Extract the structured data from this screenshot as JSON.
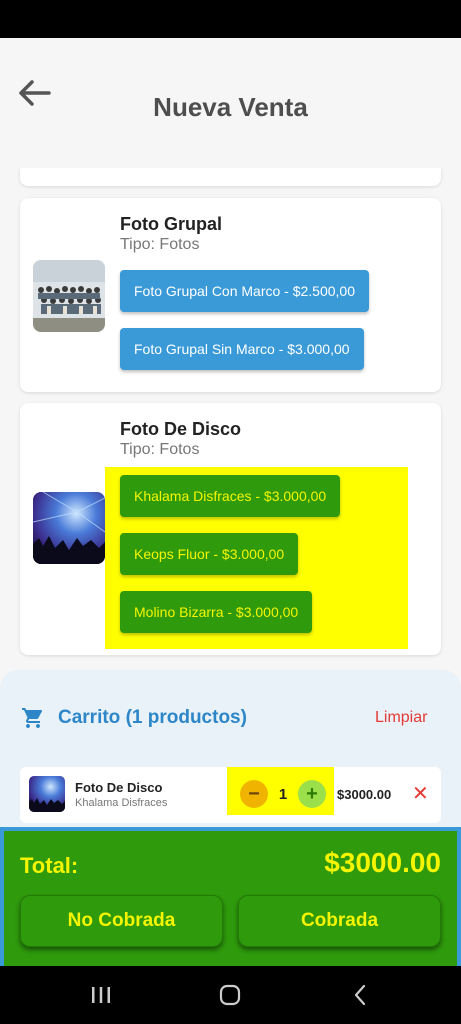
{
  "header": {
    "title": "Nueva Venta",
    "back_icon": "arrow-left-icon"
  },
  "products": [
    {
      "title": "Foto Grupal",
      "type": "Tipo: Fotos",
      "options": [
        "Foto Grupal Con Marco - $2.500,00",
        "Foto Grupal Sin Marco - $3.000,00"
      ]
    },
    {
      "title": "Foto De Disco",
      "type": "Tipo: Fotos",
      "options": [
        "Khalama Disfraces - $3.000,00",
        "Keops Fluor - $3.000,00",
        "Molino Bizarra - $3.000,00"
      ]
    }
  ],
  "cart": {
    "title": "Carrito (1 productos)",
    "clear_label": "Limpiar",
    "icon": "shopping-cart-icon",
    "items": [
      {
        "name": "Foto De Disco",
        "variant": "Khalama Disfraces",
        "quantity": "1",
        "price": "$3000.00"
      }
    ]
  },
  "totals": {
    "label": "Total:",
    "value": "$3000.00",
    "unpaid_label": "No Cobrada",
    "paid_label": "Cobrada"
  },
  "colors": {
    "accent_blue": "#3a9ad8",
    "accent_green": "#2e9a0c",
    "highlight_yellow": "#ffff00",
    "danger_red": "#e53935"
  }
}
